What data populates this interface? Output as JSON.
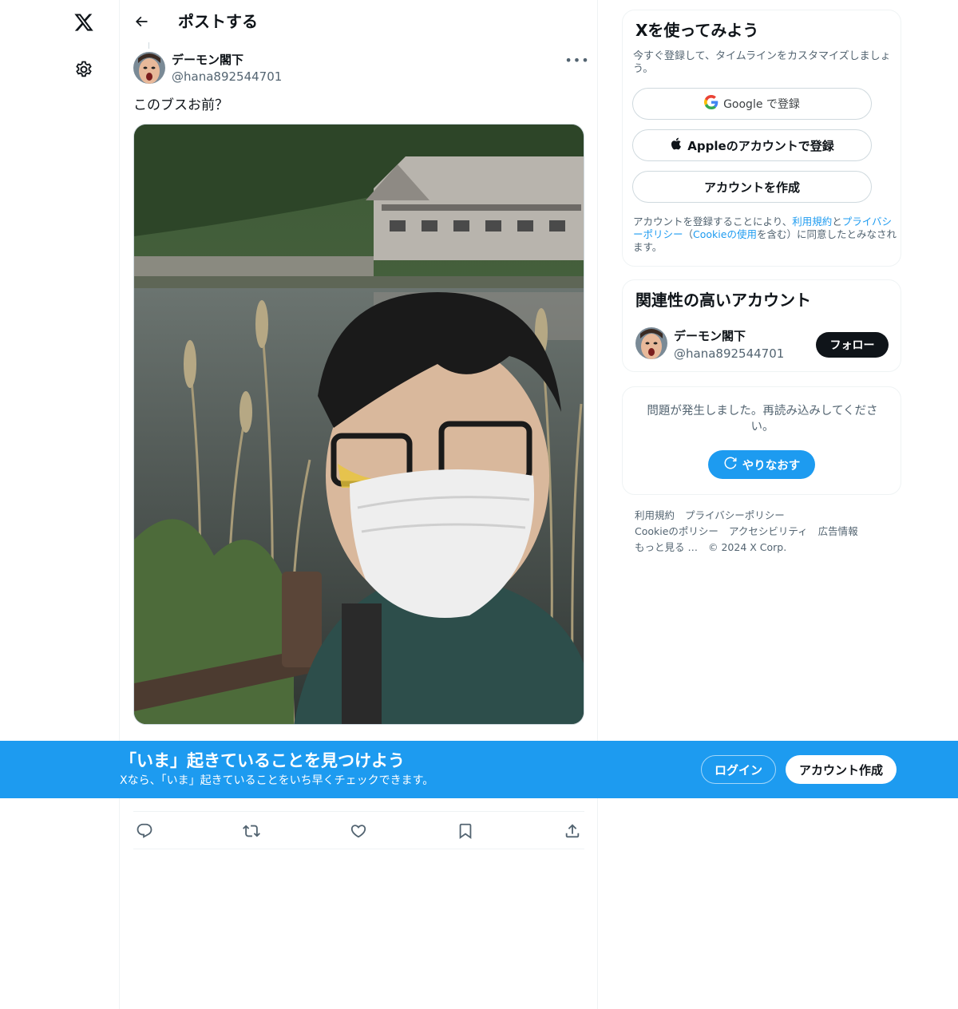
{
  "leftnav": {
    "logo_icon": "x-logo-icon",
    "settings_icon": "gear-icon"
  },
  "header": {
    "back_icon": "arrow-left-icon",
    "title": "ポストする"
  },
  "post": {
    "author_name": "デーモン閣下",
    "author_handle": "@hana892544701",
    "more_icon": "more-horizontal-icon",
    "text": "このブスお前？",
    "photo_alt": "selfie photo"
  },
  "actions": [
    {
      "name": "reply-icon"
    },
    {
      "name": "repost-icon"
    },
    {
      "name": "like-icon"
    },
    {
      "name": "bookmark-icon"
    },
    {
      "name": "share-icon"
    }
  ],
  "signup": {
    "title": "Xを使ってみよう",
    "subtitle": "今すぐ登録して、タイムラインをカスタマイズしましょう。",
    "google_label": "Google で登録",
    "apple_label": "Appleのアカウントで登録",
    "create_label": "アカウントを作成",
    "legal_prefix": "アカウントを登録することにより、",
    "legal_terms": "利用規約",
    "legal_and": "と",
    "legal_privacy": "プライバシーポリシー",
    "legal_paren_open": "（",
    "legal_cookie": "Cookieの使用",
    "legal_suffix": "を含む）に同意したとみなされます。"
  },
  "related": {
    "title": "関連性の高いアカウント",
    "name": "デーモン閣下",
    "handle": "@hana892544701",
    "follow_label": "フォロー"
  },
  "error": {
    "message": "問題が発生しました。再読み込みしてください。",
    "retry_label": "やりなおす",
    "retry_icon": "refresh-icon"
  },
  "footer": {
    "terms": "利用規約",
    "privacy": "プライバシーポリシー",
    "cookie": "Cookieのポリシー",
    "accessibility": "アクセシビリティ",
    "ads": "広告情報",
    "more": "もっと見る …",
    "copyright": "© 2024 X Corp."
  },
  "banner": {
    "title": "「いま」起きていることを見つけよう",
    "subtitle": "Xなら、「いま」起きていることをいち早くチェックできます。",
    "login_label": "ログイン",
    "create_label": "アカウント作成"
  },
  "colors": {
    "accent": "#1d9bf0",
    "text": "#0f1419",
    "muted": "#536471",
    "border": "#eff3f4"
  }
}
